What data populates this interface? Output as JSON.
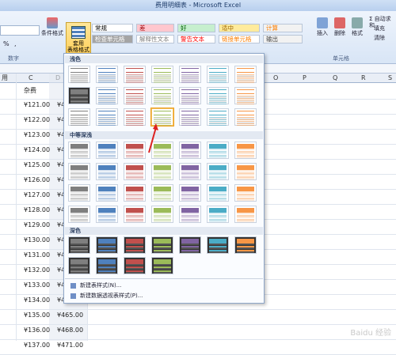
{
  "window": {
    "title": "费用明细表 - Microsoft Excel"
  },
  "ribbon": {
    "format_as_table": "套用\n表格格式",
    "conditional_format": "条件格式",
    "number_group": "数字",
    "cells_group": "单元格",
    "percent": "%",
    "comma": ",",
    "insert": "插入",
    "delete": "删除",
    "format": "格式",
    "autosum": "Σ 自动求和",
    "fill": "填充",
    "clear": "清除"
  },
  "cell_styles": [
    {
      "label": "常规",
      "bg": "#ffffff",
      "color": "#000000"
    },
    {
      "label": "差",
      "bg": "#ffc7ce",
      "color": "#9c0006"
    },
    {
      "label": "好",
      "bg": "#c6efce",
      "color": "#006100"
    },
    {
      "label": "适中",
      "bg": "#ffeb9c",
      "color": "#9c6500"
    },
    {
      "label": "计算",
      "bg": "#f2f2f2",
      "color": "#fa7d00"
    },
    {
      "label": "检查单元格",
      "bg": "#a5a5a5",
      "color": "#ffffff"
    },
    {
      "label": "解释性文本",
      "bg": "#ffffff",
      "color": "#7f7f7f"
    },
    {
      "label": "警告文本",
      "bg": "#ffffff",
      "color": "#ff0000"
    },
    {
      "label": "链接单元格",
      "bg": "#ffffff",
      "color": "#fa7d00"
    },
    {
      "label": "输出",
      "bg": "#f2f2f2",
      "color": "#3f3f3f"
    }
  ],
  "sheet": {
    "left_col_header": "用",
    "col_c": "C",
    "col_d": "D",
    "c_header": "杂费",
    "right_cols": [
      "O",
      "P",
      "Q",
      "R",
      "S"
    ],
    "rows": [
      {
        "c": "¥121.00",
        "d": "¥4"
      },
      {
        "c": "¥122.00",
        "d": "¥4"
      },
      {
        "c": "¥123.00",
        "d": "¥4"
      },
      {
        "c": "¥124.00",
        "d": "¥4"
      },
      {
        "c": "¥125.00",
        "d": "¥4"
      },
      {
        "c": "¥126.00",
        "d": "¥4"
      },
      {
        "c": "¥127.00",
        "d": "¥4"
      },
      {
        "c": "¥128.00",
        "d": "¥4"
      },
      {
        "c": "¥129.00",
        "d": "¥4"
      },
      {
        "c": "¥130.00",
        "d": "¥4"
      },
      {
        "c": "¥131.00",
        "d": "¥4"
      },
      {
        "c": "¥132.00",
        "d": "¥4"
      },
      {
        "c": "¥133.00",
        "d": "¥4"
      },
      {
        "c": "¥134.00",
        "d": "¥4"
      },
      {
        "c": "¥135.00",
        "d": "¥465.00"
      },
      {
        "c": "¥136.00",
        "d": "¥468.00"
      },
      {
        "c": "¥137.00",
        "d": "¥471.00"
      }
    ]
  },
  "gallery": {
    "light": "浅色",
    "medium": "中等深浅",
    "dark": "深色",
    "new_table_style": "新建表样式(N)...",
    "new_pivot_style": "新建数据透视表样式(P)...",
    "palette": [
      "#7f7f7f",
      "#4f81bd",
      "#c0504d",
      "#9bbb59",
      "#8064a2",
      "#4bacc6",
      "#f79646"
    ]
  },
  "watermark": "Baidu 经验"
}
